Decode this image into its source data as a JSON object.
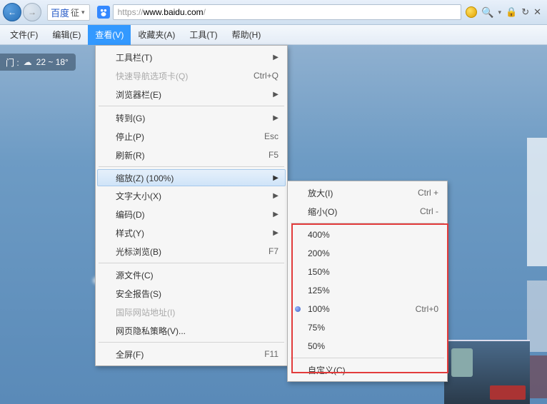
{
  "nav": {
    "baidu_label": "百度",
    "baidu_sub": "征",
    "url_proto": "https://",
    "url_domain": "www.baidu.com",
    "url_path": "/"
  },
  "menubar": {
    "file": "文件(F)",
    "edit": "编辑(E)",
    "view": "查看(V)",
    "fav": "收藏夹(A)",
    "tools": "工具(T)",
    "help": "帮助(H)"
  },
  "weather": {
    "city_suffix": "门 :",
    "temp": "22 ~ 18°"
  },
  "viewmenu": {
    "toolbar": "工具栏(T)",
    "quicknav": "快速导航选项卡(Q)",
    "quicknav_sc": "Ctrl+Q",
    "browser_bar": "浏览器栏(E)",
    "goto": "转到(G)",
    "stop": "停止(P)",
    "stop_sc": "Esc",
    "refresh": "刷新(R)",
    "refresh_sc": "F5",
    "zoom": "缩放(Z) (100%)",
    "textsize": "文字大小(X)",
    "encoding": "编码(D)",
    "style": "样式(Y)",
    "caret": "光标浏览(B)",
    "caret_sc": "F7",
    "source": "源文件(C)",
    "security": "安全报告(S)",
    "intl": "国际网站地址(I)",
    "privacy": "网页隐私策略(V)...",
    "fullscreen": "全屏(F)",
    "fullscreen_sc": "F11"
  },
  "zoommenu": {
    "in": "放大(I)",
    "in_sc": "Ctrl  +",
    "out": "缩小(O)",
    "out_sc": "Ctrl  -",
    "z400": "400%",
    "z200": "200%",
    "z150": "150%",
    "z125": "125%",
    "z100": "100%",
    "z100_sc": "Ctrl+0",
    "z75": "75%",
    "z50": "50%",
    "custom": "自定义(C)..."
  }
}
